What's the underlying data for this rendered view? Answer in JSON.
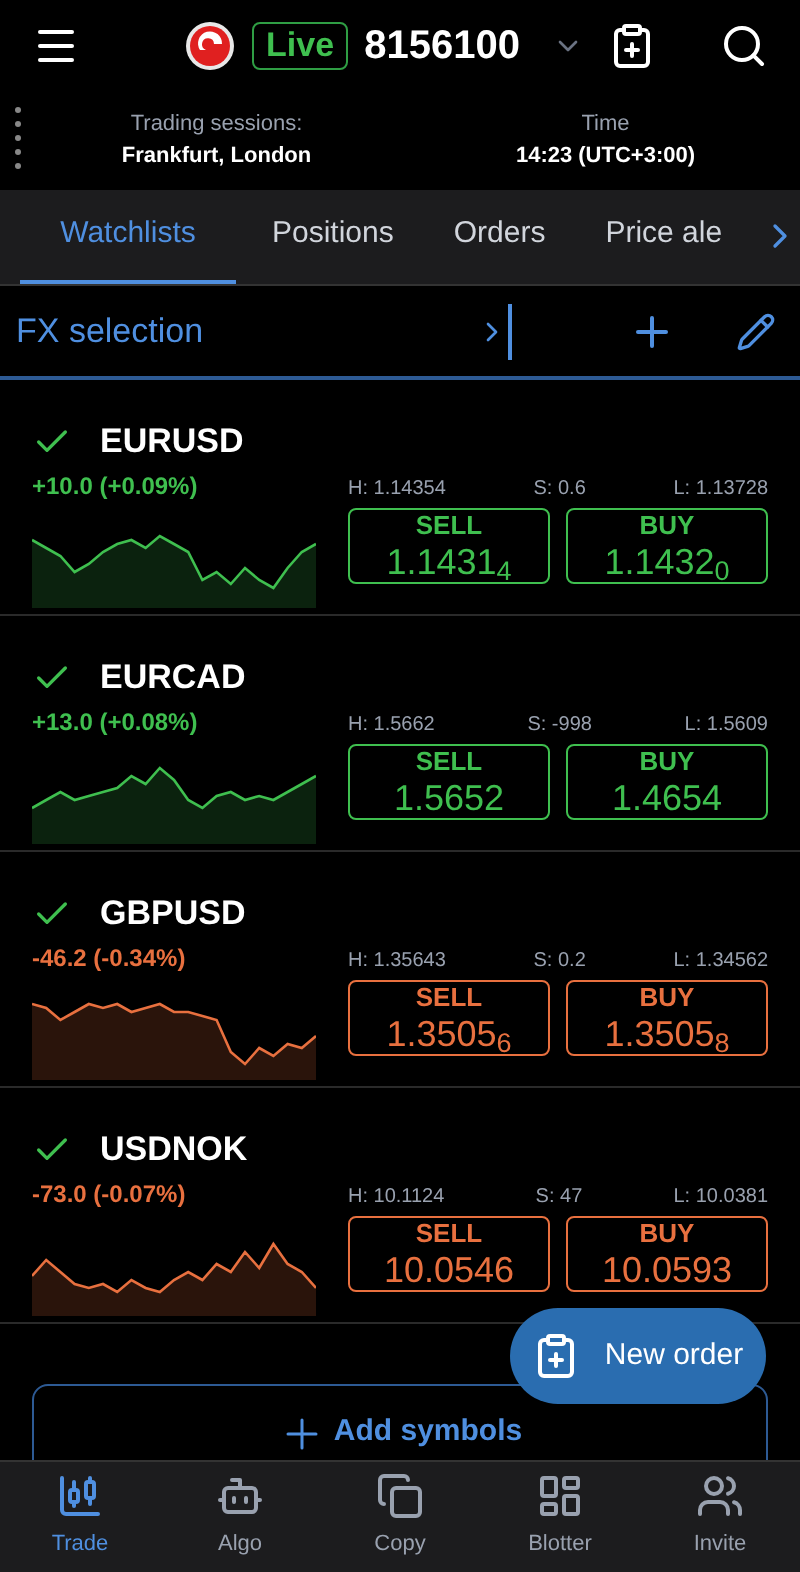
{
  "header": {
    "account_badge": "Live",
    "account_number": "8156100"
  },
  "session": {
    "label": "Trading sessions:",
    "value": "Frankfurt, London",
    "time_label": "Time",
    "time_value": "14:23 (UTC+3:00)"
  },
  "tabs": [
    {
      "label": "Watchlists",
      "selected": true
    },
    {
      "label": "Positions",
      "selected": false
    },
    {
      "label": "Orders",
      "selected": false
    },
    {
      "label": "Price ale",
      "selected": false
    }
  ],
  "watchlist": {
    "title": "FX selection"
  },
  "symbols": [
    {
      "name": "EURUSD",
      "checked": true,
      "color": "#3fbf4f",
      "change": "+10.0 (+0.09%)",
      "high": "H: 1.14354",
      "spread": "S: 0.6",
      "low": "L: 1.13728",
      "sell_label": "SELL",
      "sell": "1.1431$_{4}$",
      "buy_label": "BUY",
      "buy": "1.1432$_{0}$"
    },
    {
      "name": "EURCAD",
      "checked": true,
      "color": "#3fbf4f",
      "change": "+13.0 (+0.08%)",
      "high": "H: 1.5662",
      "spread": "S: -998",
      "low": "L: 1.5609",
      "sell_label": "SELL",
      "sell": "1.5652",
      "buy_label": "BUY",
      "buy": "1.4654"
    },
    {
      "name": "GBPUSD",
      "checked": true,
      "color": "#e8703f",
      "change": "-46.2 (-0.34%)",
      "high": "H: 1.35643",
      "spread": "S: 0.2",
      "low": "L: 1.34562",
      "sell_label": "SELL",
      "sell": "1.3505$_{6}$",
      "buy_label": "BUY",
      "buy": "1.3505$_{8}$"
    },
    {
      "name": "USDNOK",
      "checked": true,
      "color": "#e8703f",
      "change": "-73.0 (-0.07%)",
      "high": "H: 10.1124",
      "spread": "S: 47",
      "low": "L: 10.0381",
      "sell_label": "SELL",
      "sell": "10.0546",
      "buy_label": "BUY",
      "buy": "10.0593"
    }
  ],
  "add_symbols": "Add symbols",
  "new_order": "New order",
  "nav": [
    {
      "label": "Trade",
      "selected": true
    },
    {
      "label": "Algo",
      "selected": false
    },
    {
      "label": "Copy",
      "selected": false
    },
    {
      "label": "Blotter",
      "selected": false
    },
    {
      "label": "Invite",
      "selected": false
    }
  ]
}
